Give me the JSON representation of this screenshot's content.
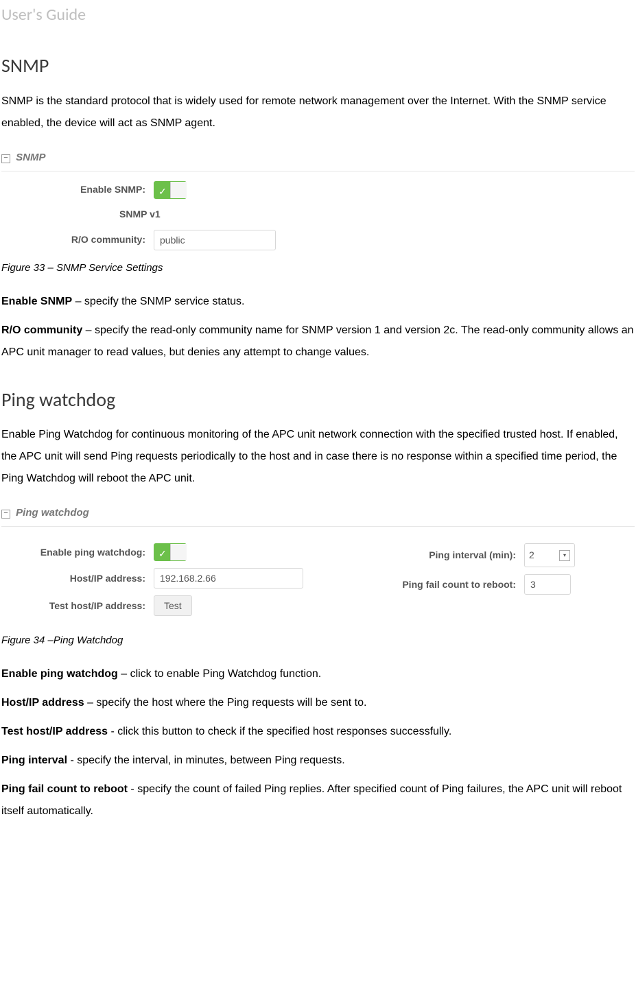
{
  "header": "User's Guide",
  "snmp": {
    "heading": "SNMP",
    "intro": "SNMP is the standard protocol that is widely used for remote network management over the Internet. With the SNMP service enabled, the device will act as SNMP agent.",
    "panel_title": "SNMP",
    "enable_label": "Enable SNMP:",
    "version_label": "SNMP v1",
    "ro_label": "R/O community:",
    "ro_value": "public",
    "caption": "Figure 33 – SNMP Service Settings",
    "def1_b": "Enable SNMP",
    "def1_t": " – specify the SNMP service status.",
    "def2_b": "R/O community",
    "def2_t": " – specify the read-only community name for SNMP version 1 and version 2c. The read-only community allows an APC unit manager to read values, but denies any attempt to change values."
  },
  "ping": {
    "heading": "Ping watchdog",
    "intro": "Enable Ping Watchdog for continuous monitoring of the APC unit network connection with the specified trusted host. If enabled, the APC unit will send Ping requests periodically to the host and in case there is no response within a specified time period, the Ping Watchdog will reboot the APC unit.",
    "panel_title": "Ping watchdog",
    "enable_label": "Enable ping watchdog:",
    "host_label": "Host/IP address:",
    "host_value": "192.168.2.66",
    "test_label": "Test host/IP address:",
    "test_btn": "Test",
    "interval_label": "Ping interval (min):",
    "interval_value": "2",
    "failcount_label": "Ping fail count to reboot:",
    "failcount_value": "3",
    "caption": "Figure 34 –Ping Watchdog",
    "def1_b": "Enable ping watchdog",
    "def1_t": " – click to enable Ping Watchdog function.",
    "def2_b": "Host/IP address",
    "def2_t": " – specify the host where the Ping requests will be sent to.",
    "def3_b": "Test host/IP address",
    "def3_t": " - click this button to check if the specified host responses successfully.",
    "def4_b": "Ping interval",
    "def4_t": " - specify the interval, in minutes, between Ping requests.",
    "def5_b": "Ping fail count to reboot",
    "def5_t": " - specify the count of failed Ping replies. After specified count of Ping failures, the APC unit will reboot itself automatically."
  }
}
